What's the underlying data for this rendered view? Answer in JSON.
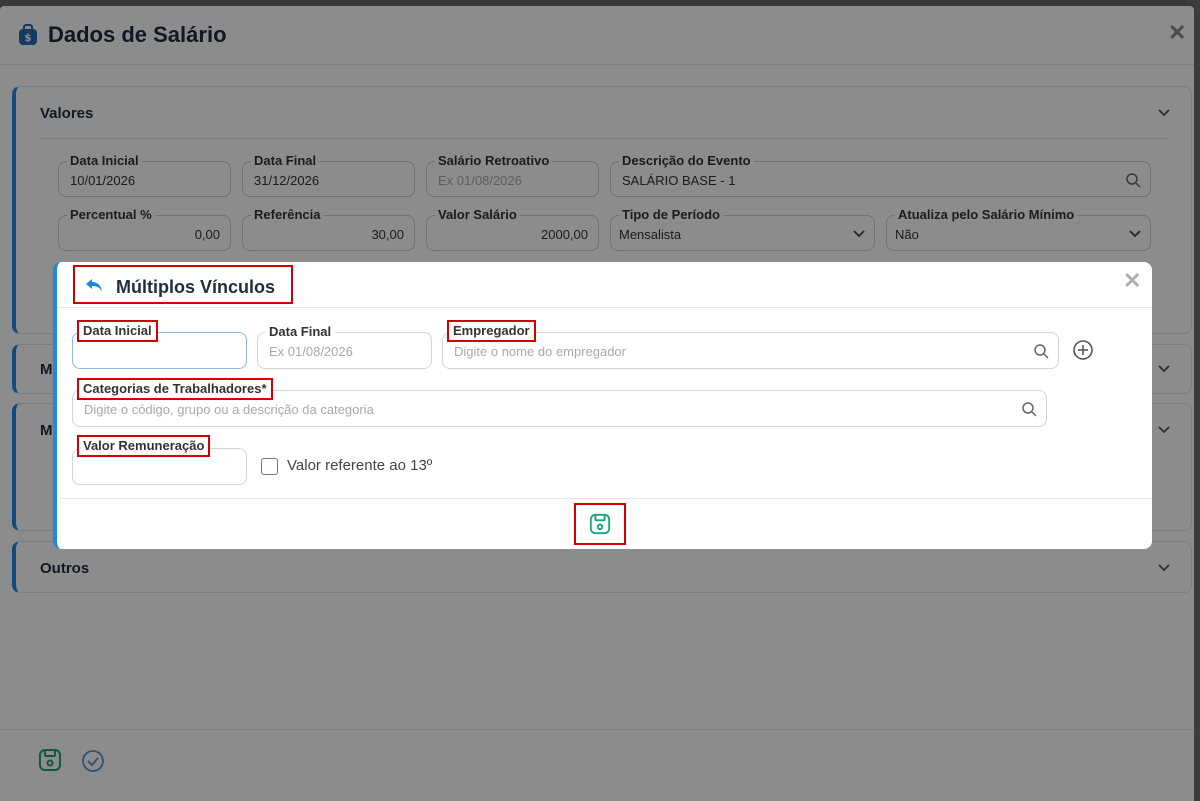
{
  "main": {
    "title": "Dados de Salário",
    "sections": {
      "valores": "Valores",
      "m1": "M",
      "m2": "M",
      "outros": "Outros"
    },
    "fields": {
      "data_inicial": {
        "label": "Data Inicial",
        "value": "10/01/2026"
      },
      "data_final": {
        "label": "Data Final",
        "value": "31/12/2026"
      },
      "salario_retroativo": {
        "label": "Salário Retroativo",
        "placeholder": "Ex 01/08/2026"
      },
      "descricao_evento": {
        "label": "Descrição do Evento",
        "value": "SALÁRIO BASE - 1"
      },
      "percentual": {
        "label": "Percentual %",
        "value": "0,00"
      },
      "referencia": {
        "label": "Referência",
        "value": "30,00"
      },
      "valor_salario": {
        "label": "Valor Salário",
        "value": "2000,00"
      },
      "tipo_periodo": {
        "label": "Tipo de Período",
        "value": "Mensalista"
      },
      "atualiza_minimo": {
        "label": "Atualiza pelo Salário Mínimo",
        "value": "Não"
      }
    }
  },
  "dialog": {
    "title": "Múltiplos Vínculos",
    "fields": {
      "data_inicial": {
        "label": "Data Inicial",
        "value": ""
      },
      "data_final": {
        "label": "Data Final",
        "placeholder": "Ex 01/08/2026"
      },
      "empregador": {
        "label": "Empregador",
        "placeholder": "Digite o nome do empregador"
      },
      "categorias": {
        "label": "Categorias de Trabalhadores*",
        "placeholder": "Digite o código, grupo ou a descrição da categoria"
      },
      "valor_remuneracao": {
        "label": "Valor Remuneração",
        "value": ""
      }
    },
    "checkbox_label": "Valor referente ao 13º",
    "checkbox_checked": false
  },
  "colors": {
    "accent_blue": "#1e88e5",
    "save_green": "#1aa37a",
    "highlight_red": "#d40000"
  },
  "icons": [
    "bag-dollar-icon",
    "close-icon",
    "search-icon",
    "chevron-down-icon",
    "reply-arrow-icon",
    "plus-circle-icon",
    "save-icon",
    "check-circle-icon"
  ]
}
